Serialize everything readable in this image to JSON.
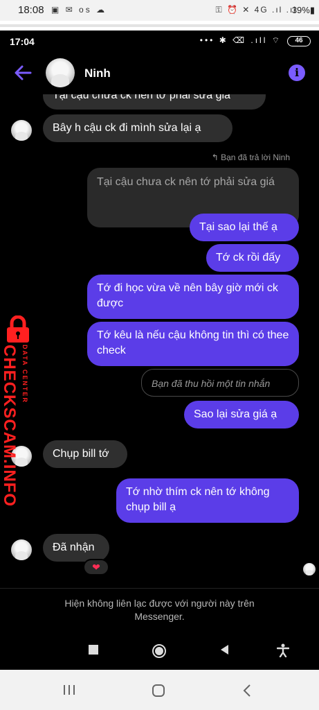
{
  "outer_status": {
    "time": "18:08",
    "left_icons": "▣ ✉ os ☁",
    "right_icons": "⚿ ⏰ ✕ 4G .ıl .ıl",
    "battery": "39%▮"
  },
  "inner_status": {
    "time": "17:04",
    "icons": "••• ✱ ⌫ .ıll ⌔",
    "battery": "46"
  },
  "header": {
    "contact_name": "Ninh"
  },
  "icons": {
    "back": "back-arrow-icon",
    "info": "info-icon",
    "heart": "heart-icon"
  },
  "colors": {
    "accent": "#7b5cff",
    "outgoing_bubble": "#5b3de8",
    "incoming_bubble": "#2f2f2f",
    "watermark": "#ff2020"
  },
  "messages": {
    "m0": "Tại cậu chưa ck nên tớ phải sửa giá",
    "m1": "Bây h cậu ck đi mình sửa lại ạ",
    "reply_label": "↰ Bạn đã trả lời Ninh",
    "reply_quote": "Tại cậu chưa ck nên tớ phải sửa giá",
    "m2": "Tại sao lại thế ạ",
    "m3": "Tớ ck rồi đấy",
    "m4": "Tớ đi học vừa về nên bây giờ mới ck được",
    "m5": "Tớ kêu là nếu cậu không tin thì có thee check",
    "unsent": "Bạn đã thu hồi một tin nhắn",
    "m6": "Sao lại sửa giá ạ",
    "m7": "Chụp bill tớ",
    "m8": "Tớ nhờ thím ck nên tớ không chụp bill ạ",
    "m9": "Đã nhận",
    "reaction": "❤"
  },
  "watermark": {
    "small": "DATA CENTER",
    "big": "CHECKSCAM.INFO"
  },
  "footer": {
    "line1": "Hiện không liên lạc được với người này trên",
    "line2": "Messenger."
  },
  "inner_nav": {
    "square": "■",
    "home": "◉",
    "back": "◀",
    "accessibility": "✝"
  },
  "outer_nav": {
    "recents": "|||",
    "home": "○",
    "back": "〈"
  }
}
